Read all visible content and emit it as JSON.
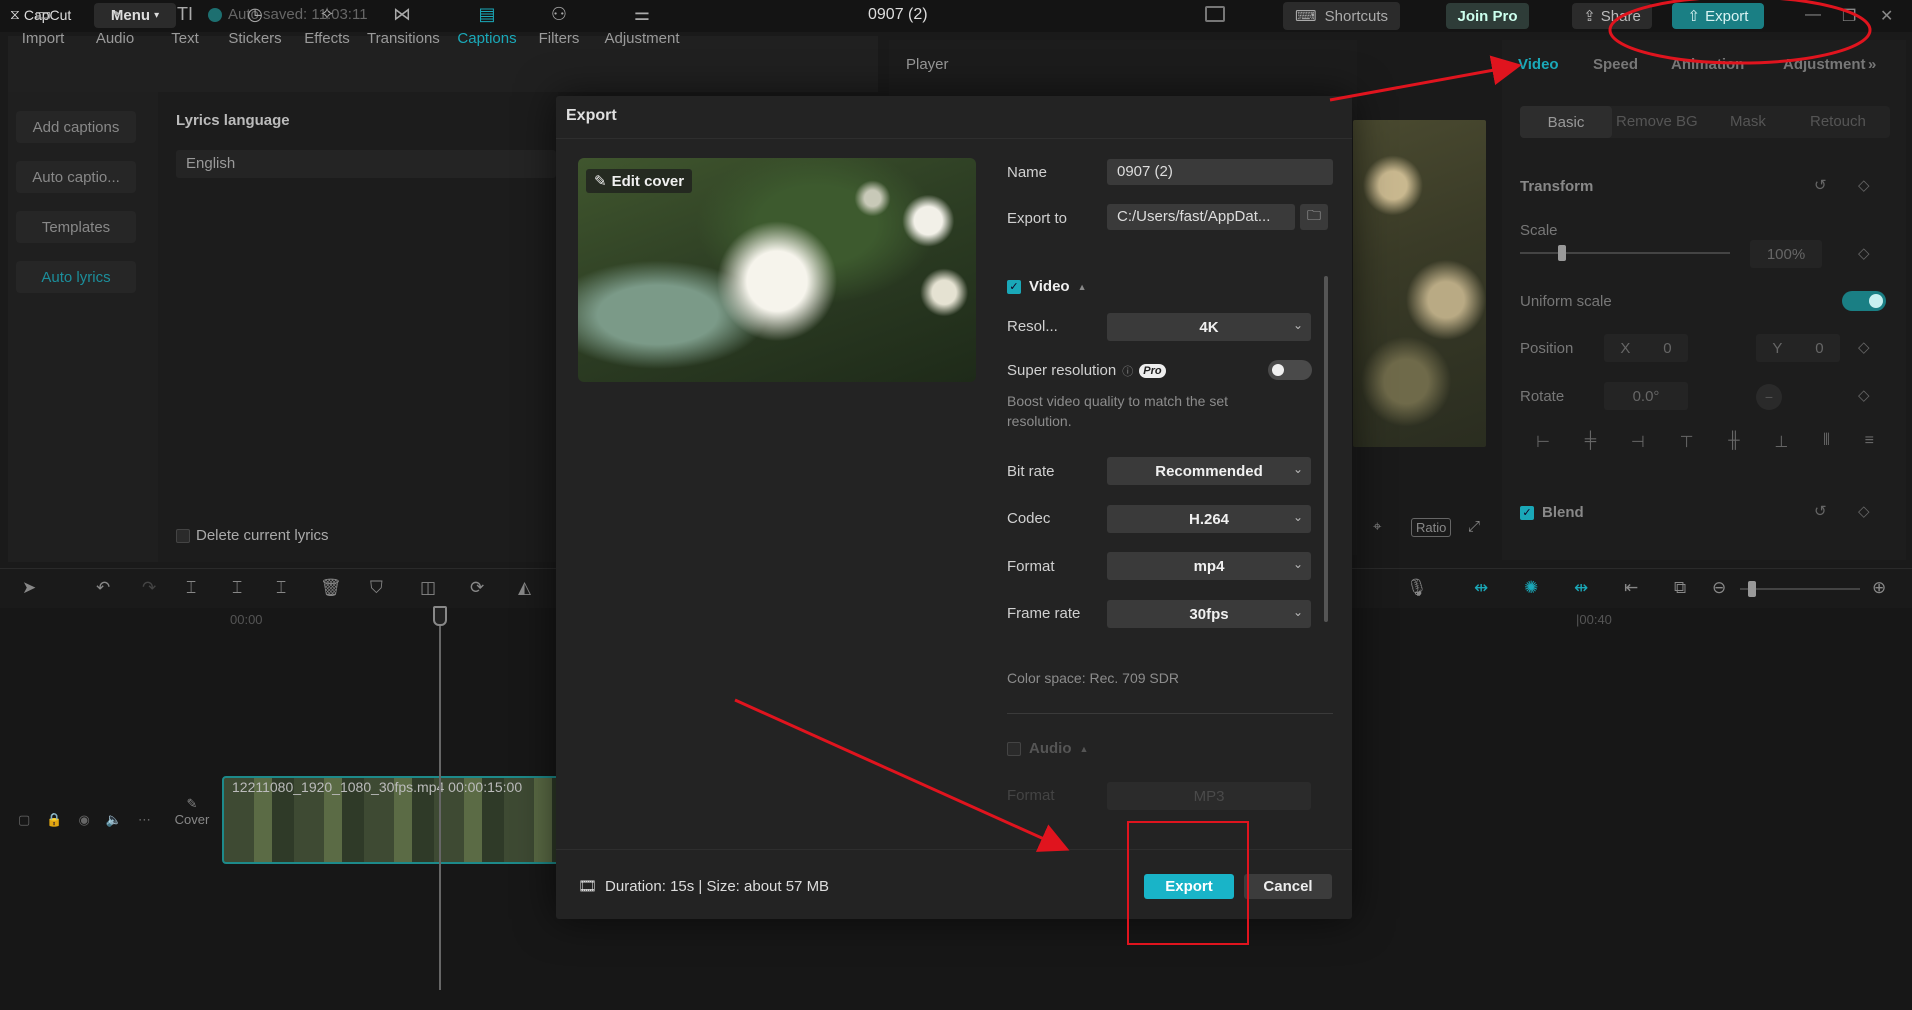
{
  "titlebar": {
    "app_name": "CapCut",
    "menu_label": "Menu",
    "autosave": "Auto saved: 11:03:11",
    "project_title": "0907 (2)",
    "shortcuts_label": "Shortcuts",
    "join_pro_label": "Join Pro",
    "share_label": "Share",
    "export_label": "Export"
  },
  "toolbar": {
    "items": [
      {
        "label": "Import",
        "icon": "import-icon"
      },
      {
        "label": "Audio",
        "icon": "audio-icon"
      },
      {
        "label": "Text",
        "icon": "text-icon"
      },
      {
        "label": "Stickers",
        "icon": "stickers-icon"
      },
      {
        "label": "Effects",
        "icon": "effects-icon"
      },
      {
        "label": "Transitions",
        "icon": "transitions-icon"
      },
      {
        "label": "Captions",
        "icon": "captions-icon"
      },
      {
        "label": "Filters",
        "icon": "filters-icon"
      },
      {
        "label": "Adjustment",
        "icon": "adjustment-icon"
      }
    ],
    "active": "Captions"
  },
  "leftnav": {
    "items": [
      "Add captions",
      "Auto captio...",
      "Templates",
      "Auto lyrics"
    ],
    "active": "Auto lyrics"
  },
  "lyrics": {
    "language_label": "Lyrics language",
    "language_value": "English",
    "delete_label": "Delete current lyrics"
  },
  "player": {
    "label": "Player",
    "ratio_label": "Ratio"
  },
  "rightpanel": {
    "tabs": [
      "Video",
      "Speed",
      "Animation",
      "Adjustment"
    ],
    "active_tab": "Video",
    "subtabs": [
      "Basic",
      "Remove BG",
      "Mask",
      "Retouch"
    ],
    "active_subtab": "Basic",
    "transform_label": "Transform",
    "scale_label": "Scale",
    "scale_value": "100%",
    "uniform_label": "Uniform scale",
    "position_label": "Position",
    "pos_x_label": "X",
    "pos_x": "0",
    "pos_y_label": "Y",
    "pos_y": "0",
    "rotate_label": "Rotate",
    "rotate_value": "0.0°",
    "blend_label": "Blend"
  },
  "timeline": {
    "ruler_start": "00:00",
    "ruler_mark": "|00:40",
    "clip_label": "12211080_1920_1080_30fps.mp4   00:00:15:00",
    "cover_label": "Cover"
  },
  "dialog": {
    "title": "Export",
    "edit_cover": "Edit cover",
    "name_label": "Name",
    "name_value": "0907 (2)",
    "export_to_label": "Export to",
    "export_to_value": "C:/Users/fast/AppDat...",
    "video_label": "Video",
    "resolution_label": "Resol...",
    "resolution_value": "4K",
    "super_res_label": "Super resolution",
    "pro_badge": "Pro",
    "super_res_hint": "Boost video quality to match the set resolution.",
    "bitrate_label": "Bit rate",
    "bitrate_value": "Recommended",
    "codec_label": "Codec",
    "codec_value": "H.264",
    "format_label": "Format",
    "format_value": "mp4",
    "framerate_label": "Frame rate",
    "framerate_value": "30fps",
    "color_space": "Color space: Rec. 709 SDR",
    "audio_label": "Audio",
    "audio_format_label": "Format",
    "audio_format_value": "MP3",
    "duration_info": "Duration: 15s | Size: about 57 MB",
    "export_button": "Export",
    "cancel_button": "Cancel"
  },
  "colors": {
    "accent": "#1aa8b8",
    "annotation": "#e0141e",
    "background": "#1a1a1a"
  }
}
